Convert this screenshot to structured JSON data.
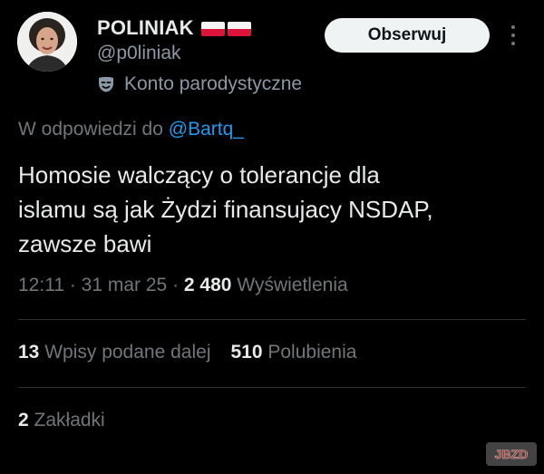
{
  "author": {
    "display_name": "POLINIAK",
    "flag_icons": [
      "poland-flag-icon",
      "poland-flag-icon"
    ],
    "handle": "@p0liniak",
    "label_icon": "parody-mask-icon",
    "label": "Konto parodystyczne"
  },
  "follow_button": "Obserwuj",
  "more_icon": "more-vertical-icon",
  "reply": {
    "prefix": "W odpowiedzi do ",
    "mention": "@Bartq_"
  },
  "tweet": {
    "text": "Homosie walczący o tolerancje dla\nislamu są jak Żydzi finansujacy NSDAP,\nzawsze bawi"
  },
  "meta": {
    "time": "12:11",
    "date": "31 mar 25",
    "separator": " · ",
    "views_count": "2 480",
    "views_label": "Wyświetlenia"
  },
  "stats": {
    "reposts_count": "13",
    "reposts_label": "Wpisy podane dalej",
    "likes_count": "510",
    "likes_label": "Polubienia",
    "bookmarks_count": "2",
    "bookmarks_label": "Zakładki"
  },
  "watermark": {
    "text": "JBZD"
  },
  "colors": {
    "background": "#000000",
    "text_primary": "#e7e9ea",
    "text_secondary": "#71767b",
    "link": "#1d9bf0",
    "divider": "#2f3336",
    "button_bg": "#eff3f4"
  }
}
